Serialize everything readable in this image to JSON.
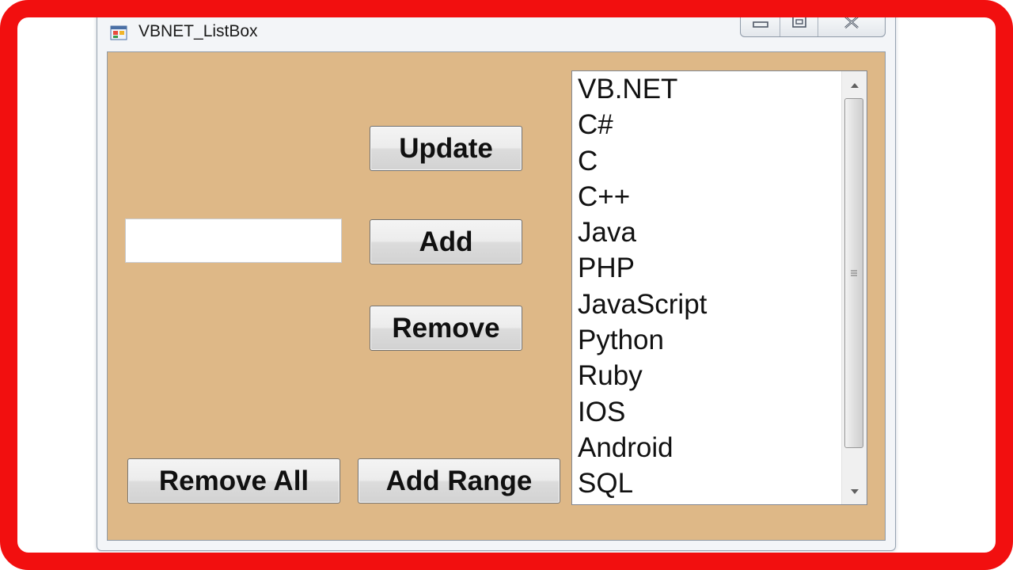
{
  "window": {
    "title": "VBNET_ListBox",
    "icon": "winforms-app-icon",
    "caption_buttons": [
      "minimize-icon",
      "maximize-icon",
      "close-icon"
    ]
  },
  "form": {
    "background": "#deb887",
    "textbox": {
      "value": ""
    },
    "buttons": {
      "update": "Update",
      "add": "Add",
      "remove": "Remove",
      "remove_all": "Remove All",
      "add_range": "Add Range"
    },
    "listbox": {
      "items": [
        "VB.NET",
        "C#",
        "C",
        "C++",
        "Java",
        "PHP",
        "JavaScript",
        "Python",
        "Ruby",
        "IOS",
        "Android",
        "SQL"
      ]
    }
  },
  "frame_color": "#f20f0f"
}
